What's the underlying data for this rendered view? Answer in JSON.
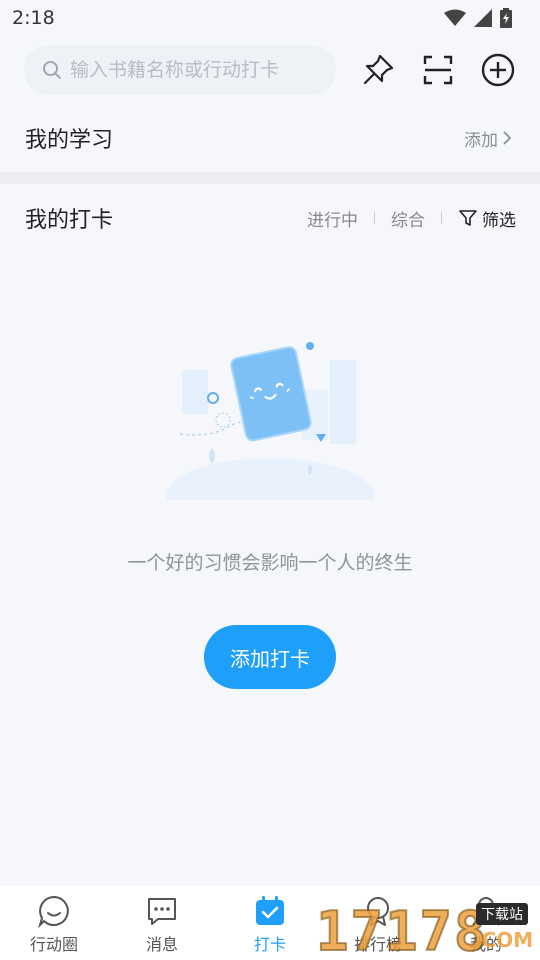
{
  "status_bar": {
    "time": "2:18"
  },
  "search": {
    "placeholder": "输入书籍名称或行动打卡"
  },
  "top_actions": [
    "pin-icon",
    "scan-icon",
    "add-circle-icon"
  ],
  "study_section": {
    "title": "我的学习",
    "add_label": "添加"
  },
  "checkin_section": {
    "title": "我的打卡",
    "filters": [
      "进行中",
      "综合"
    ],
    "filter_button_label": "筛选"
  },
  "empty_state": {
    "slogan": "一个好的习惯会影响一个人的终生",
    "button_label": "添加打卡"
  },
  "tabs": [
    {
      "label": "行动圈",
      "icon": "chat-bubble-icon"
    },
    {
      "label": "消息",
      "icon": "message-icon"
    },
    {
      "label": "打卡",
      "icon": "calendar-check-icon",
      "active": true
    },
    {
      "label": "排行榜",
      "icon": "trophy-icon"
    },
    {
      "label": "我的",
      "icon": "person-icon"
    }
  ],
  "watermark": {
    "number": "17178",
    "badge": "下载站",
    "suffix": ".COM"
  },
  "colors": {
    "accent": "#1e9ffa",
    "background": "#f5f7fa"
  }
}
